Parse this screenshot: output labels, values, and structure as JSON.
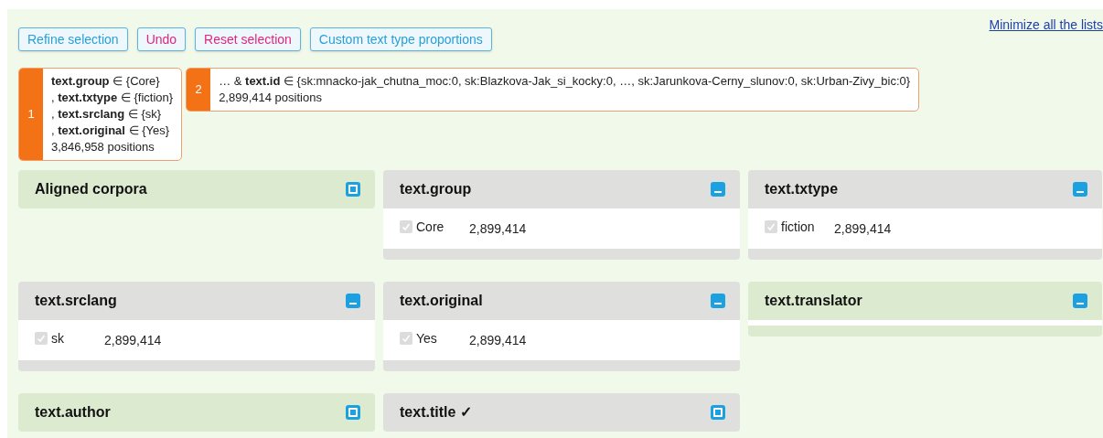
{
  "toolbar": {
    "buttons": [
      {
        "label": "Refine selection",
        "kind": "primary"
      },
      {
        "label": "Undo",
        "kind": "danger"
      },
      {
        "label": "Reset selection",
        "kind": "danger"
      },
      {
        "label": "Custom text type proportions",
        "kind": "primary"
      }
    ],
    "link": "Minimize all the lists"
  },
  "steps": [
    {
      "number": "1",
      "lines": [
        "**text.group** ∈ {Core}",
        ", **text.txtype** ∈ {fiction}",
        ", **text.srclang** ∈ {sk}",
        ", **text.original** ∈ {Yes}"
      ],
      "positions": "3,846,958 positions"
    },
    {
      "number": "2",
      "lines": [
        "… & **text.id** ∈ {sk:mnacko-jak_chutna_moc:0, sk:Blazkova-Jak_si_kocky:0, …, sk:Jarunkova-Cerny_slunov:0, sk:Urban-Zivy_bic:0}"
      ],
      "positions": "2,899,414 positions"
    }
  ],
  "panels": [
    {
      "title": "Aligned corpora",
      "active": false,
      "expanded": false
    },
    {
      "title": "text.group",
      "active": true,
      "expanded": true,
      "items": [
        {
          "label": "Core",
          "count": "2,899,414",
          "checked": true
        }
      ]
    },
    {
      "title": "text.txtype",
      "active": true,
      "expanded": true,
      "items": [
        {
          "label": "fiction",
          "count": "2,899,414",
          "checked": true
        }
      ]
    },
    {
      "title": "text.srclang",
      "active": true,
      "expanded": true,
      "items": [
        {
          "label": "sk",
          "count": "2,899,414",
          "checked": true
        }
      ]
    },
    {
      "title": "text.original",
      "active": true,
      "expanded": true,
      "items": [
        {
          "label": "Yes",
          "count": "2,899,414",
          "checked": true
        }
      ]
    },
    {
      "title": "text.translator",
      "active": false,
      "expanded": true
    },
    {
      "title": "text.author",
      "active": false,
      "expanded": false
    },
    {
      "title": "text.title ✓",
      "active": true,
      "expanded": false
    }
  ]
}
